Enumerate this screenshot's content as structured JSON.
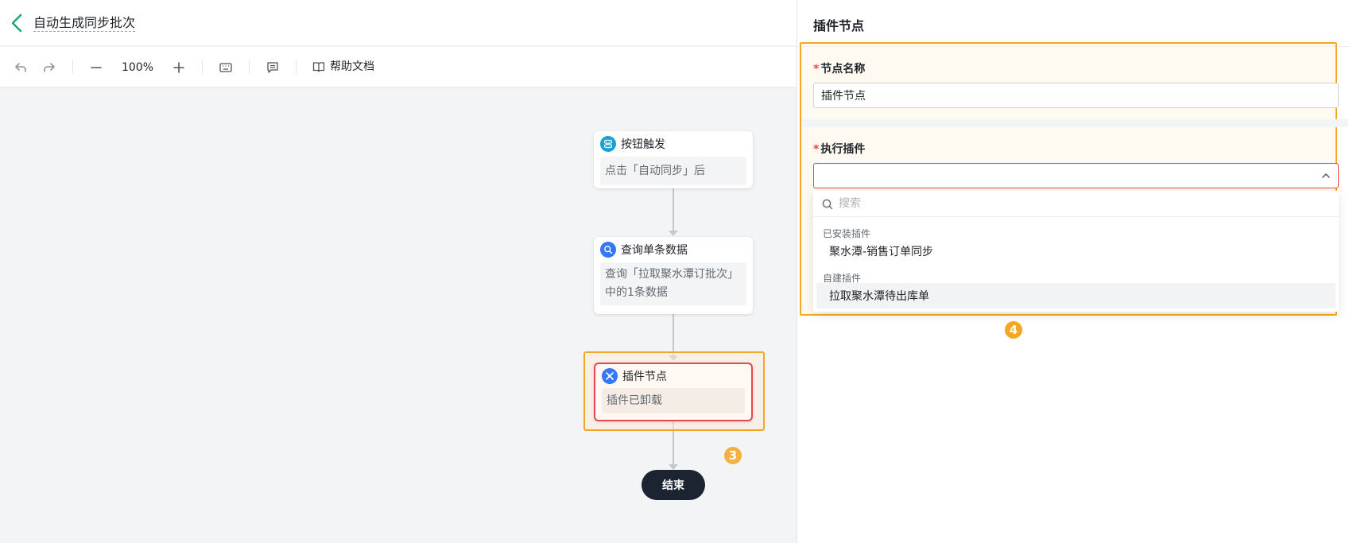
{
  "header": {
    "title": "自动生成同步批次"
  },
  "toolbar": {
    "zoom": "100%",
    "help_label": "帮助文档",
    "icons": [
      "undo-icon",
      "redo-icon",
      "zoom-out-icon",
      "zoom-in-icon",
      "keyboard-icon",
      "note-icon",
      "book-icon"
    ]
  },
  "canvas": {
    "nodes": [
      {
        "title": "按钮触发",
        "body": "点击「自动同步」后",
        "icon": "button-trigger-icon",
        "color": "#1aa1d6"
      },
      {
        "title": "查询单条数据",
        "body": "查询「拉取聚水潭订批次」中的1条数据",
        "icon": "search-icon",
        "color": "#3478f6"
      },
      {
        "title": "插件节点",
        "body": "插件已卸载",
        "icon": "plugin-icon",
        "color": "#3478f6"
      }
    ],
    "end_label": "结束",
    "badge_3": "3"
  },
  "panel": {
    "title": "插件节点",
    "node_name_label": "节点名称",
    "node_name_value": "插件节点",
    "exec_plugin_label": "执行插件",
    "required_mark": "*",
    "badge_4": "4",
    "dropdown": {
      "search_placeholder": "搜索",
      "installed_group": "已安装插件",
      "installed_items": [
        "聚水潭-销售订单同步"
      ],
      "custom_group": "自建插件",
      "custom_items": [
        "拉取聚水潭待出库单"
      ]
    }
  },
  "colors": {
    "accent_teal": "#1aa37a",
    "highlight_orange": "#f5a623",
    "error_red": "#e5484d",
    "end_node": "#1b2430"
  }
}
